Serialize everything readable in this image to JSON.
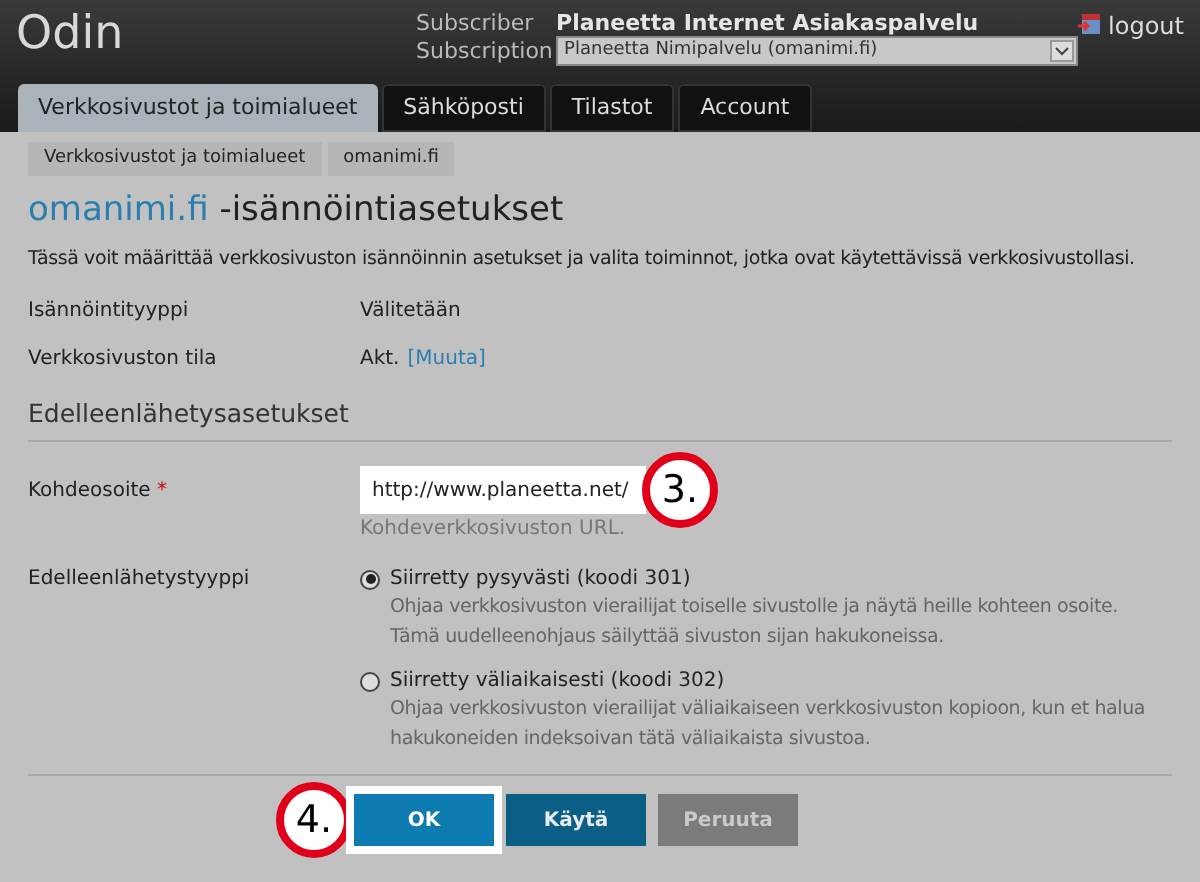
{
  "header": {
    "logo": "Odin",
    "subscriber_label": "Subscriber",
    "subscriber": "Planeetta Internet Asiakaspalvelu",
    "subscription_label": "Subscription",
    "subscription": "Planeetta Nimipalvelu (omanimi.fi)",
    "logout": "logout"
  },
  "tabs": [
    {
      "label": "Verkkosivustot ja toimialueet",
      "selected": true
    },
    {
      "label": "Sähköposti",
      "selected": false
    },
    {
      "label": "Tilastot",
      "selected": false
    },
    {
      "label": "Account",
      "selected": false
    }
  ],
  "breadcrumb": [
    "Verkkosivustot ja toimialueet",
    "omanimi.fi"
  ],
  "title": {
    "link": "omanimi.fi",
    "rest": "-isännöintiasetukset"
  },
  "description": "Tässä voit määrittää verkkosivuston isännöinnin asetukset ja valita toiminnot, jotka ovat käytettävissä verkkosivustollasi.",
  "info": [
    {
      "label": "Isännöintityyppi",
      "value": "Välitetään"
    },
    {
      "label": "Verkkosivuston tila",
      "value": "Akt.",
      "link": "[Muuta]"
    }
  ],
  "section": "Edelleenlähetysasetukset",
  "field": {
    "label": "Kohdeosoite",
    "required": "*",
    "value": "http://www.planeetta.net/",
    "hint": "Kohdeverkkosivuston URL.",
    "callout": "3."
  },
  "radio_group": {
    "label": "Edelleenlähetystyyppi",
    "options": [
      {
        "label": "Siirretty pysyvästi (koodi 301)",
        "selected": true,
        "description": "Ohjaa verkkosivuston vierailijat toiselle sivustolle ja näytä heille kohteen osoite. Tämä uudelleenohjaus säilyttää sivuston sijan hakukoneissa."
      },
      {
        "label": "Siirretty väliaikaisesti (koodi 302)",
        "selected": false,
        "description": "Ohjaa verkkosivuston vierailijat väliaikaiseen verkkosivuston kopioon, kun et halua hakukoneiden indeksoivan tätä väliaikaista sivustoa."
      }
    ]
  },
  "buttons": [
    {
      "label": "OK",
      "kind": "primary",
      "highlighted": true
    },
    {
      "label": "Käytä",
      "kind": "secondary",
      "highlighted": false
    },
    {
      "label": "Peruuta",
      "kind": "disabled",
      "highlighted": false
    }
  ],
  "buttons_callout": "4."
}
